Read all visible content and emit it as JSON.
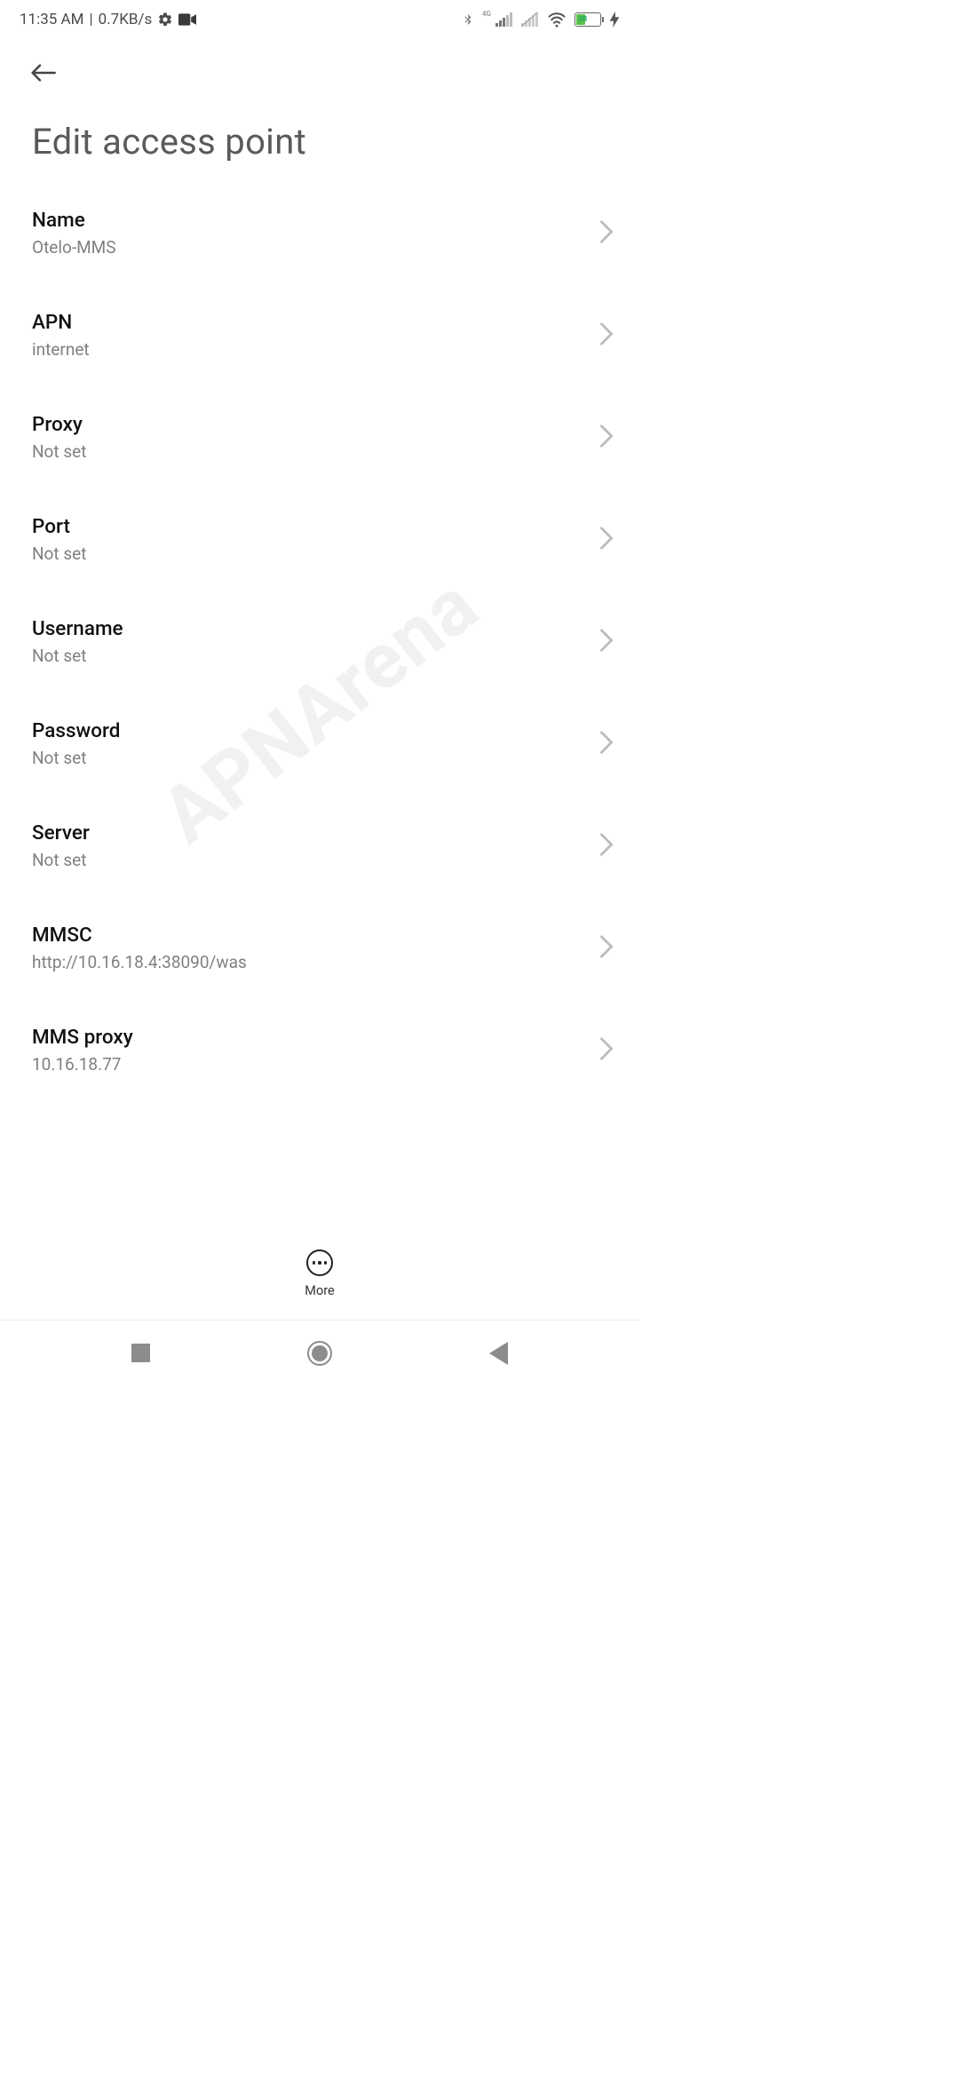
{
  "status": {
    "time": "11:35 AM",
    "sep": "|",
    "rate": "0.7KB/s",
    "net_label": "4G",
    "battery_pct": "38"
  },
  "header": {
    "title": "Edit access point"
  },
  "rows": [
    {
      "label": "Name",
      "value": "Otelo-MMS"
    },
    {
      "label": "APN",
      "value": "internet"
    },
    {
      "label": "Proxy",
      "value": "Not set"
    },
    {
      "label": "Port",
      "value": "Not set"
    },
    {
      "label": "Username",
      "value": "Not set"
    },
    {
      "label": "Password",
      "value": "Not set"
    },
    {
      "label": "Server",
      "value": "Not set"
    },
    {
      "label": "MMSC",
      "value": "http://10.16.18.4:38090/was"
    },
    {
      "label": "MMS proxy",
      "value": "10.16.18.77"
    }
  ],
  "bottom": {
    "more": "More"
  },
  "watermark": "APNArena"
}
